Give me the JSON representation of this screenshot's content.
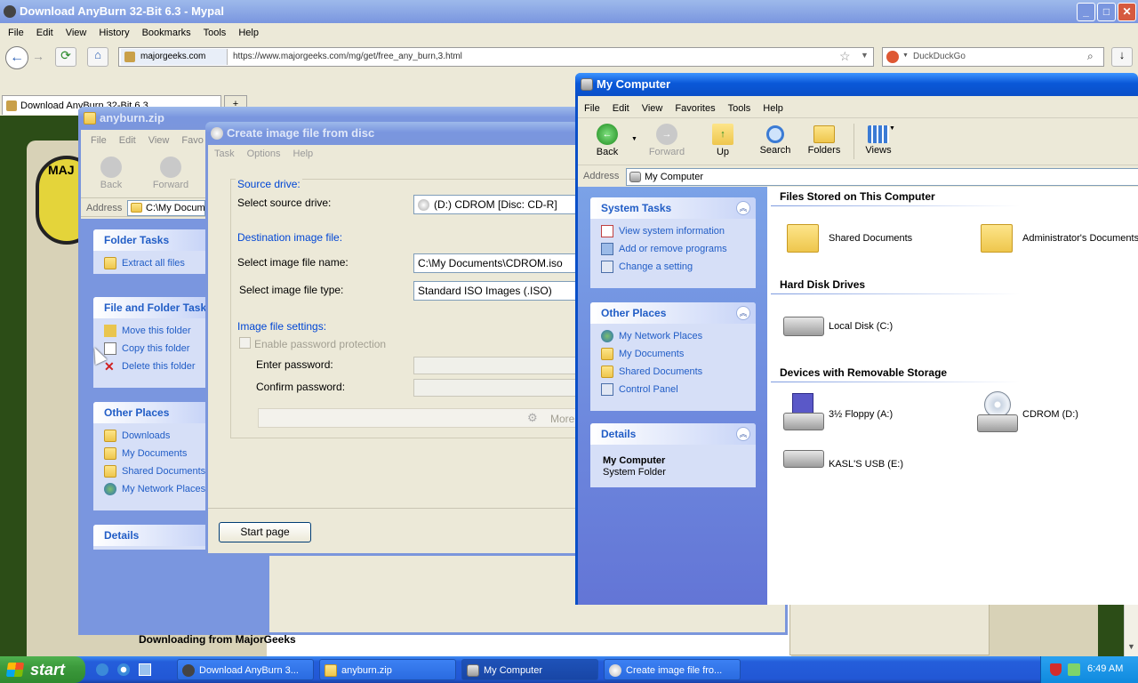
{
  "browser": {
    "title": "Download AnyBurn 32-Bit 6.3 - Mypal",
    "menu": [
      "File",
      "Edit",
      "View",
      "History",
      "Bookmarks",
      "Tools",
      "Help"
    ],
    "identity": "majorgeeks.com",
    "url": "https://www.majorgeeks.com/mg/get/free_any_burn,3.html",
    "search_engine": "DuckDuckGo",
    "tab_label": "Download AnyBurn 32-Bit 6.3",
    "tab_new": "+",
    "page_heading": "Downloading from MajorGeeks",
    "logo_text": "MAJ"
  },
  "anyburn_zip": {
    "title": "anyburn.zip",
    "menu": [
      "File",
      "Edit",
      "View",
      "Favo"
    ],
    "back": "Back",
    "forward": "Forward",
    "address_label": "Address",
    "address": "C:\\My Docume",
    "folder_tasks": {
      "title": "Folder Tasks",
      "items": [
        "Extract all files"
      ]
    },
    "file_folder_tasks": {
      "title": "File and Folder Tasks",
      "items": [
        "Move this folder",
        "Copy this folder",
        "Delete this folder"
      ]
    },
    "other_places": {
      "title": "Other Places",
      "items": [
        "Downloads",
        "My Documents",
        "Shared Documents",
        "My Network Places"
      ]
    },
    "details": {
      "title": "Details"
    }
  },
  "create_image": {
    "title": "Create image file from disc",
    "menu": [
      "Task",
      "Options",
      "Help"
    ],
    "source_group": "Source drive:",
    "source_label": "Select source drive:",
    "source_value": "(D:) CDROM [Disc: CD-R]",
    "dest_group": "Destination image file:",
    "dest_name_label": "Select image file name:",
    "dest_name_value": "C:\\My Documents\\CDROM.iso",
    "dest_type_label": "Select image file type:",
    "dest_type_value": "Standard ISO Images (.ISO)",
    "settings_group": "Image file settings:",
    "enable_password": "Enable password protection",
    "enter_password": "Enter password:",
    "confirm_password": "Confirm password:",
    "more": "More",
    "start_page": "Start page"
  },
  "my_computer": {
    "title": "My Computer",
    "menu": [
      "File",
      "Edit",
      "View",
      "Favorites",
      "Tools",
      "Help"
    ],
    "toolbar": {
      "back": "Back",
      "forward": "Forward",
      "up": "Up",
      "search": "Search",
      "folders": "Folders",
      "views": "Views"
    },
    "address_label": "Address",
    "address": "My Computer",
    "system_tasks": {
      "title": "System Tasks",
      "items": [
        "View system information",
        "Add or remove programs",
        "Change a setting"
      ]
    },
    "other_places": {
      "title": "Other Places",
      "items": [
        "My Network Places",
        "My Documents",
        "Shared Documents",
        "Control Panel"
      ]
    },
    "details": {
      "title": "Details",
      "name": "My Computer",
      "type": "System Folder"
    },
    "sections": {
      "files": "Files Stored on This Computer",
      "hdd": "Hard Disk Drives",
      "removable": "Devices with Removable Storage"
    },
    "items": {
      "shared_docs": "Shared Documents",
      "admin_docs": "Administrator's Documents",
      "local_disk": "Local Disk (C:)",
      "floppy": "3½ Floppy (A:)",
      "cdrom": "CDROM (D:)",
      "usb": "KASL'S USB (E:)"
    }
  },
  "taskbar": {
    "start": "start",
    "tasks": [
      "Download AnyBurn 3...",
      "anyburn.zip",
      "My Computer",
      "Create image file fro..."
    ],
    "clock": "6:49 AM"
  },
  "colors": {
    "xp_blue": "#0a58d8",
    "panel_blue": "#7a96df",
    "link_blue": "#215dc6",
    "taskbar_blue": "#245edb",
    "start_green": "#3c9a3c"
  }
}
